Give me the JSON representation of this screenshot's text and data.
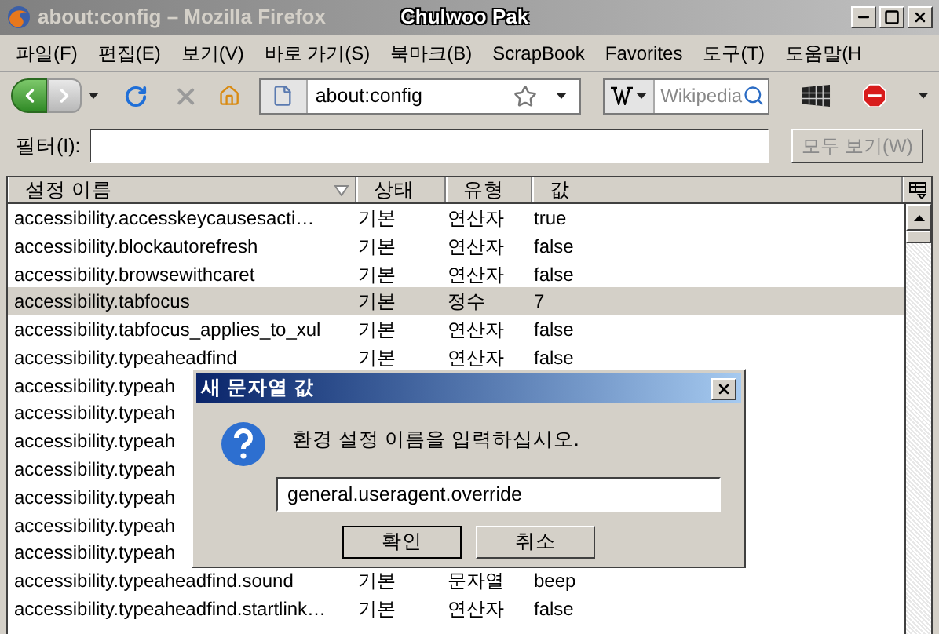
{
  "window": {
    "title": "about:config – Mozilla Firefox",
    "user_label": "Chulwoo Pak"
  },
  "menu": [
    "파일(F)",
    "편집(E)",
    "보기(V)",
    "바로 가기(S)",
    "북마크(B)",
    "ScrapBook",
    "Favorites",
    "도구(T)",
    "도움말(H"
  ],
  "toolbar": {
    "address": "about:config",
    "search_placeholder": "Wikipedia"
  },
  "filter": {
    "label": "필터(I):",
    "button": {
      "label": "모두 보기(W)",
      "disabled": true
    }
  },
  "table": {
    "columns": [
      "설정 이름",
      "상태",
      "유형",
      "값"
    ],
    "rows": [
      {
        "name": "accessibility.accesskeycausesacti…",
        "status": "기본",
        "type": "연산자",
        "value": "true",
        "selected": false
      },
      {
        "name": "accessibility.blockautorefresh",
        "status": "기본",
        "type": "연산자",
        "value": "false",
        "selected": false
      },
      {
        "name": "accessibility.browsewithcaret",
        "status": "기본",
        "type": "연산자",
        "value": "false",
        "selected": false
      },
      {
        "name": "accessibility.tabfocus",
        "status": "기본",
        "type": "정수",
        "value": "7",
        "selected": true
      },
      {
        "name": "accessibility.tabfocus_applies_to_xul",
        "status": "기본",
        "type": "연산자",
        "value": "false",
        "selected": false
      },
      {
        "name": "accessibility.typeaheadfind",
        "status": "기본",
        "type": "연산자",
        "value": "false",
        "selected": false
      },
      {
        "name": "accessibility.typeah",
        "selected": false
      },
      {
        "name": "accessibility.typeah",
        "selected": false
      },
      {
        "name": "accessibility.typeah",
        "selected": false
      },
      {
        "name": "accessibility.typeah",
        "selected": false
      },
      {
        "name": "accessibility.typeah",
        "selected": false
      },
      {
        "name": "accessibility.typeah",
        "selected": false
      },
      {
        "name": "accessibility.typeah",
        "selected": false
      },
      {
        "name": "accessibility.typeaheadfind.sound",
        "status": "기본",
        "type": "문자열",
        "value": "beep",
        "selected": false
      },
      {
        "name": "accessibility.typeaheadfind.startlink…",
        "status": "기본",
        "type": "연산자",
        "value": "false",
        "selected": false
      }
    ]
  },
  "dialog": {
    "title": "새 문자열 값",
    "message": "환경 설정 이름을 입력하십시오.",
    "value": "general.useragent.override",
    "buttons": [
      "확인",
      "취소"
    ]
  }
}
